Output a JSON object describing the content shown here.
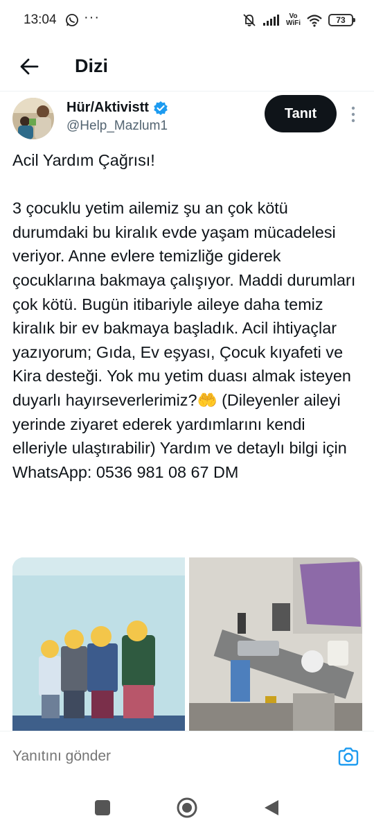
{
  "status_bar": {
    "time": "13:04",
    "more": "···",
    "vowifi_top": "Vo",
    "vowifi_bottom": "WiFi",
    "battery": "73",
    "icons": [
      "whatsapp-icon",
      "mute-icon",
      "signal-icon",
      "wifi-icon"
    ]
  },
  "header": {
    "title": "Dizi",
    "back_icon": "arrow-left-icon"
  },
  "tweet": {
    "author_name": "Hür/Aktivistt",
    "verified_color": "#1d9bf0",
    "handle": "@Help_Mazlum1",
    "follow_label": "Tanıt",
    "text": "Acil Yardım Çağrısı!\n\n3 çocuklu yetim ailemiz şu an çok kötü durumdaki bu kiralık evde yaşam mücadelesi veriyor. Anne evlere temizliğe giderek çocuklarına bakmaya çalışıyor. Maddi durumları çok kötü. Bugün itibariyle aileye daha temiz kiralık bir ev bakmaya başladık. Acil ihtiyaçlar yazıyorum; Gıda, Ev eşyası, Çocuk kıyafeti ve Kira desteği. Yok mu yetim duası almak isteyen duyarlı hayırseverlerimiz?🤲 (Dileyenler aileyi yerinde ziyaret ederek yardımlarını kendi elleriyle ulaştırabilir) Yardım ve detaylı bilgi için WhatsApp: 0536 981 08 67 DM"
  },
  "reply": {
    "placeholder": "Yanıtını gönder",
    "camera_icon": "camera-icon",
    "accent": "#1d9bf0"
  }
}
